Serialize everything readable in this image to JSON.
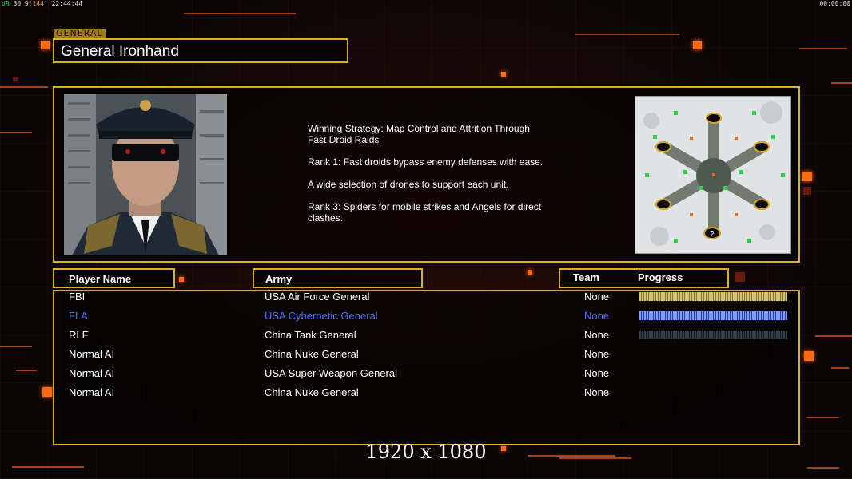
{
  "hud": {
    "left_prefix": "UR",
    "left_fps": "30 9",
    "left_bracket": "[144]",
    "left_time": "22:44:44",
    "right_time": "00:00:00"
  },
  "general": {
    "tab_label": "GENERAL",
    "name": "General Ironhand"
  },
  "strategy": {
    "lines": [
      "Winning Strategy: Map Control and Attrition Through\n Fast Droid Raids",
      "Rank 1: Fast droids bypass enemy defenses with ease.",
      "A wide selection of drones to support each unit.",
      "Rank 3: Spiders for mobile strikes and Angels for direct\n clashes."
    ]
  },
  "minimap": {
    "player_marker": "2"
  },
  "table": {
    "headers": {
      "player_name": "Player Name",
      "army": "Army",
      "team": "Team",
      "progress": "Progress"
    },
    "rows": [
      {
        "name": "FBI",
        "army": "USA Air Force General",
        "team": "None",
        "progress_style": "gold"
      },
      {
        "name": "FLA",
        "army": "USA Cybernetic General",
        "team": "None",
        "progress_style": "blue",
        "highlight": "#4a6dff"
      },
      {
        "name": "RLF",
        "army": "China Tank General",
        "team": "None",
        "progress_style": "dark"
      },
      {
        "name": "Normal AI",
        "army": "China Nuke General",
        "team": "None"
      },
      {
        "name": "Normal AI",
        "army": "USA Super Weapon General",
        "team": "None"
      },
      {
        "name": "Normal AI",
        "army": "China Nuke General",
        "team": "None"
      }
    ]
  },
  "footer": {
    "resolution": "1920 x 1080"
  },
  "colors": {
    "frame_gold": "#d8b21a",
    "accent_orange": "#ff6a10",
    "highlight_blue": "#4a6dff"
  }
}
